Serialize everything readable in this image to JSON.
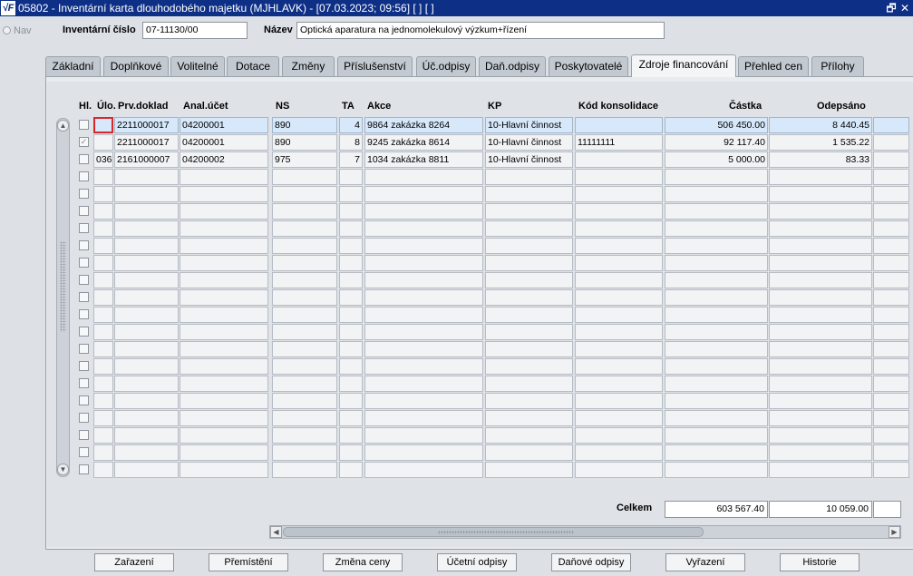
{
  "window": {
    "icon_text": "√F",
    "title": "05802 - Inventární karta dlouhodobého majetku (MJHLAVK) - [07.03.2023; 09:56]  [ ]  [ ]",
    "restore_glyph": "🗗",
    "close_glyph": "✕"
  },
  "nav": {
    "label": "Nav"
  },
  "header": {
    "inv_label": "Inventární číslo",
    "inv_value": "07-11130/00",
    "name_label": "Název",
    "name_value": "Optická aparatura na jednomolekulový výzkum+řízení"
  },
  "tabs": [
    "Základní",
    "Doplňkové",
    "Volitelné",
    "Dotace",
    "Změny",
    "Příslušenství",
    "Úč.odpisy",
    "Daň.odpisy",
    "Poskytovatelé",
    "Zdroje financování",
    "Přehled cen",
    "Přílohy"
  ],
  "active_tab": "Zdroje financování",
  "columns": {
    "hl": "Hl.",
    "ulo": "Úlo.",
    "prv": "Prv.doklad",
    "anal": "Anal.účet",
    "ns": "NS",
    "ta": "TA",
    "akce": "Akce",
    "kp": "KP",
    "kod": "Kód konsolidace",
    "castka": "Částka",
    "odepsano": "Odepsáno"
  },
  "rows": [
    {
      "hl_checked": false,
      "ulo": "",
      "prv": "2211000017",
      "anal": "04200001",
      "ns": "890",
      "ta": "4",
      "akce": "9864 zakázka 8264",
      "kp": "10-Hlavní činnost",
      "kod": "",
      "castka": "506 450.00",
      "odepsano": "8 440.45"
    },
    {
      "hl_checked": true,
      "ulo": "",
      "prv": "2211000017",
      "anal": "04200001",
      "ns": "890",
      "ta": "8",
      "akce": "9245 zakázka 8614",
      "kp": "10-Hlavní činnost",
      "kod": "11111111",
      "castka": "92 117.40",
      "odepsano": "1 535.22"
    },
    {
      "hl_checked": false,
      "ulo": "036",
      "prv": "2161000007",
      "anal": "04200002",
      "ns": "975",
      "ta": "7",
      "akce": "1034 zakázka 8811",
      "kp": "10-Hlavní činnost",
      "kod": "",
      "castka": "5 000.00",
      "odepsano": "83.33"
    }
  ],
  "totals": {
    "label": "Celkem",
    "castka": "603 567.40",
    "odepsano": "10 059.00"
  },
  "buttons": [
    "Zařazení",
    "Přemístění",
    "Změna ceny",
    "Účetní odpisy",
    "Daňové odpisy",
    "Vyřazení",
    "Historie"
  ],
  "scroll": {
    "up": "▲",
    "down": "▼",
    "left": "◀",
    "right": "▶"
  }
}
